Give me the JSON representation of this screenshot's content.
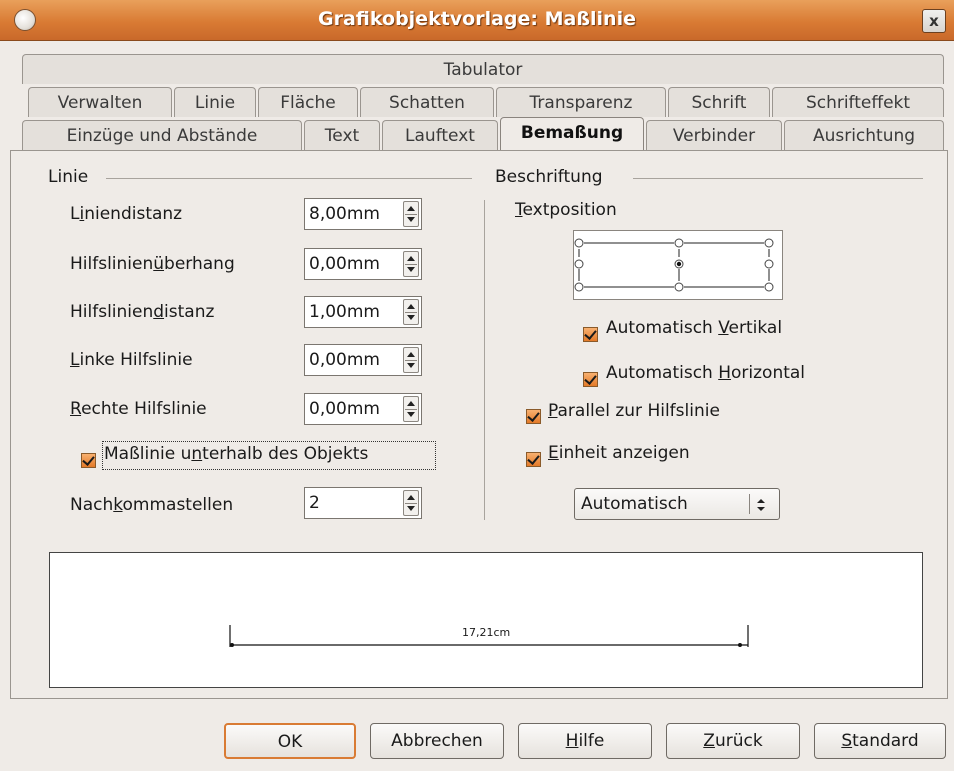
{
  "window": {
    "title": "Grafikobjektvorlage: Maßlinie",
    "close_label": "x"
  },
  "tabs": {
    "row1": [
      "Tabulator"
    ],
    "row2": [
      "Verwalten",
      "Linie",
      "Fläche",
      "Schatten",
      "Transparenz",
      "Schrift",
      "Schrifteffekt"
    ],
    "row3": [
      "Einzüge und Abstände",
      "Text",
      "Lauftext",
      "Bemaßung",
      "Verbinder",
      "Ausrichtung"
    ],
    "active": "Bemaßung"
  },
  "linie": {
    "group_label": "Linie",
    "liniendistanz": {
      "label_pre": "L",
      "label_u": "i",
      "label_post": "niendistanz",
      "value": "8,00mm"
    },
    "ueberhang": {
      "label_pre": "Hilfslinien",
      "label_u": "ü",
      "label_post": "berhang",
      "value": "0,00mm"
    },
    "hilfsdistanz": {
      "label_pre": "Hilfslinien",
      "label_u": "d",
      "label_post": "istanz",
      "value": "1,00mm"
    },
    "linke": {
      "label_pre": "",
      "label_u": "L",
      "label_post": "inke Hilfslinie",
      "value": "0,00mm"
    },
    "rechte": {
      "label_pre": "",
      "label_u": "R",
      "label_post": "echte Hilfslinie",
      "value": "0,00mm"
    },
    "unterhalb": {
      "label_pre": "Maßlinie u",
      "label_u": "n",
      "label_post": "terhalb des Objekts",
      "checked": true
    },
    "nachkomma": {
      "label_pre": "Nach",
      "label_u": "k",
      "label_post": "ommastellen",
      "value": "2"
    }
  },
  "beschriftung": {
    "group_label": "Beschriftung",
    "textposition": {
      "label_pre": "",
      "label_u": "T",
      "label_post": "extposition"
    },
    "auto_vertikal": {
      "label_pre": "Automatisch ",
      "label_u": "V",
      "label_post": "ertikal",
      "checked": true
    },
    "auto_horizontal": {
      "label_pre": "Automatisch ",
      "label_u": "H",
      "label_post": "orizontal",
      "checked": true
    },
    "parallel": {
      "label_pre": "",
      "label_u": "P",
      "label_post": "arallel zur Hilfslinie",
      "checked": true
    },
    "einheit": {
      "label_pre": "",
      "label_u": "E",
      "label_post": "inheit anzeigen",
      "checked": true
    },
    "einheit_select": "Automatisch"
  },
  "preview": {
    "dimension_text": "17,21cm"
  },
  "buttons": {
    "ok": "OK",
    "abbrechen": "Abbrechen",
    "hilfe": {
      "pre": "",
      "u": "H",
      "post": "ilfe"
    },
    "zurueck": {
      "pre": "",
      "u": "Z",
      "post": "urück"
    },
    "standard": {
      "pre": "",
      "u": "S",
      "post": "tandard"
    }
  },
  "colors": {
    "titlebar": "#d97b34",
    "checkbox": "#e47a28",
    "dialog_bg": "#efebe7"
  }
}
